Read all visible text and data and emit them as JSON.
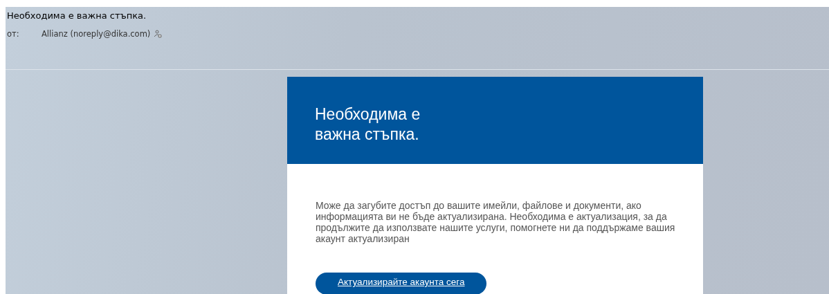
{
  "email": {
    "subject": "Необходима е важна стъпка.",
    "from_label": "от:",
    "sender": "Allianz (noreply@dika.com)"
  },
  "message": {
    "heading_lines": [
      "Необходима е",
      "важна стъпка."
    ],
    "body": "Може да загубите достъп до вашите имейли, файлове и документи, ако информацията ви не бъде актуализирана. Необходима е актуализация, за да продължите да използвате нашите услуги, помогнете ни да поддържаме вашия акаунт актуализиран",
    "button": "Актуализирайте акаунта сега"
  }
}
